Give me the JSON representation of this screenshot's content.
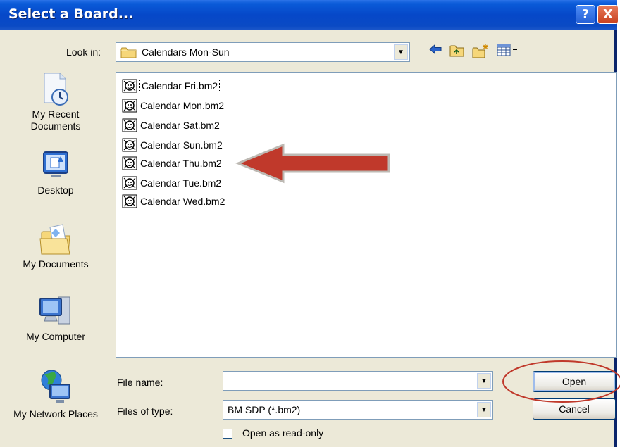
{
  "window": {
    "title": "Select a Board...",
    "help_glyph": "?",
    "close_glyph": "X"
  },
  "look_in": {
    "label": "Look in:",
    "value": "Calendars Mon-Sun"
  },
  "toolbar": {
    "icons": [
      "back-icon",
      "up-folder-icon",
      "new-folder-icon",
      "views-menu-icon"
    ]
  },
  "places": [
    {
      "label": "My Recent Documents",
      "icon": "recent-documents-icon"
    },
    {
      "label": "Desktop",
      "icon": "desktop-icon"
    },
    {
      "label": "My Documents",
      "icon": "my-documents-icon"
    },
    {
      "label": "My Computer",
      "icon": "my-computer-icon"
    },
    {
      "label": "My Network Places",
      "icon": "network-places-icon"
    }
  ],
  "files": [
    {
      "name": "Calendar Fri.bm2"
    },
    {
      "name": "Calendar Mon.bm2"
    },
    {
      "name": "Calendar Sat.bm2"
    },
    {
      "name": "Calendar Sun.bm2"
    },
    {
      "name": "Calendar Thu.bm2"
    },
    {
      "name": "Calendar Tue.bm2"
    },
    {
      "name": "Calendar Wed.bm2"
    }
  ],
  "file_name": {
    "label": "File name:",
    "value": ""
  },
  "file_type": {
    "label": "Files of type:",
    "value": "BM SDP (*.bm2)"
  },
  "buttons": {
    "open": "Open",
    "cancel": "Cancel"
  },
  "read_only": {
    "label": "Open as read-only",
    "checked": false
  },
  "colors": {
    "title_bar": "#0a4ac4",
    "annotation": "#c0392b"
  }
}
